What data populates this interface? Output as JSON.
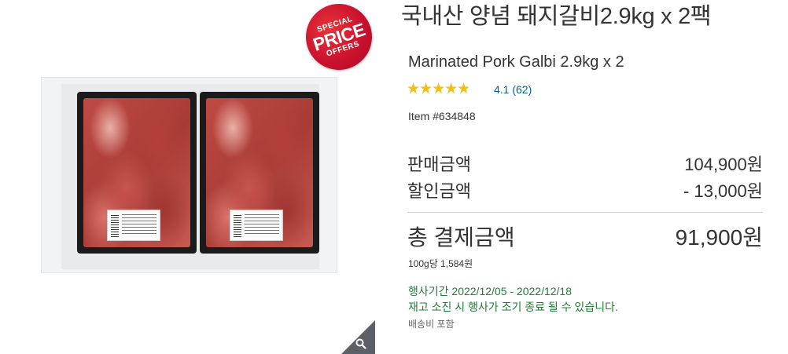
{
  "badge": {
    "line1": "SPECIAL",
    "line2": "PRICE",
    "line3": "OFFERS"
  },
  "product": {
    "title_ko": "국내산 양념 돼지갈비2.9kg x 2팩",
    "title_en": "Marinated Pork Galbi 2.9kg x 2",
    "rating": {
      "stars": 4.1,
      "label": "4.1 (62)"
    },
    "item_number": "Item #634848"
  },
  "pricing": {
    "sale_label": "판매금액",
    "sale_value": "104,900원",
    "discount_label": "할인금액",
    "discount_value": "- 13,000원",
    "total_label": "총 결제금액",
    "total_value": "91,900원",
    "unit_price": "100g당 1,584원"
  },
  "promotion": {
    "period": "행사기간 2022/12/05 - 2022/12/18",
    "notice": "재고 소진 시 행사가 조기 종료 될 수 있습니다."
  },
  "shipping": "배송비 포함",
  "colors": {
    "badge": "#c8102e",
    "star": "#f2bf1a",
    "link": "#0060a9",
    "promo": "#1e7d34"
  },
  "icons": {
    "zoom": "magnifier-icon",
    "rating": "star-icon"
  }
}
